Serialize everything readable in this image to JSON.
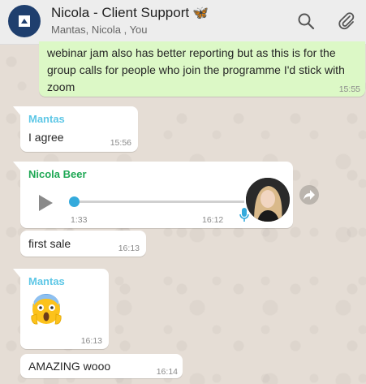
{
  "header": {
    "title": "Nicola - Client Support",
    "butterfly": "🦋",
    "subtitle": "Mantas, Nicola , You",
    "icons": [
      "search-icon",
      "paperclip-icon"
    ]
  },
  "messages": [
    {
      "direction": "outgoing",
      "lines": [
        "webinar jam also has better reporting but as this is for the",
        "group calls for people who join the programme I'd stick with",
        "zoom"
      ],
      "time": "15:55"
    },
    {
      "direction": "incoming",
      "sender": "Mantas",
      "text": "I agree",
      "time": "15:56"
    },
    {
      "direction": "incoming",
      "sender": "Nicola Beer",
      "type": "voice-note",
      "duration": "1:33",
      "progress": 0.0,
      "time": "16:12"
    },
    {
      "direction": "incoming",
      "text": "first sale",
      "time": "16:13"
    },
    {
      "direction": "incoming",
      "sender": "Mantas",
      "type": "emoji",
      "emoji": "😱",
      "time": "16:13"
    },
    {
      "direction": "incoming",
      "text": "AMAZING wooo",
      "time": "16:14"
    }
  ],
  "colors": {
    "mantas": "#5ec7e6",
    "nicola_beer": "#1fa855",
    "outgoing_bubble": "#dcf8c6",
    "incoming_bubble": "#ffffff",
    "chat_background": "#e5ddd5"
  }
}
